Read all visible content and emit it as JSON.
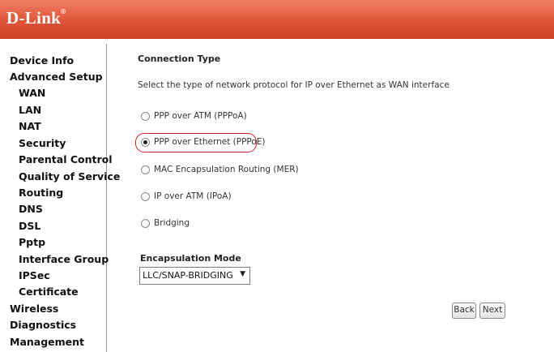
{
  "brand": {
    "logo": "D-Link",
    "tm": "®"
  },
  "sidebar": {
    "items": [
      {
        "label": "Device Info"
      },
      {
        "label": "Advanced Setup"
      },
      {
        "label": "WAN"
      },
      {
        "label": "LAN"
      },
      {
        "label": "NAT"
      },
      {
        "label": "Security"
      },
      {
        "label": "Parental Control"
      },
      {
        "label": "Quality of Service"
      },
      {
        "label": "Routing"
      },
      {
        "label": "DNS"
      },
      {
        "label": "DSL"
      },
      {
        "label": "Pptp"
      },
      {
        "label": "Interface Group"
      },
      {
        "label": "IPSec"
      },
      {
        "label": "Certificate"
      },
      {
        "label": "Wireless"
      },
      {
        "label": "Diagnostics"
      },
      {
        "label": "Management"
      }
    ]
  },
  "main": {
    "title": "Connection Type",
    "description": "Select the type of network protocol for IP over Ethernet as WAN interface",
    "options": [
      {
        "label": "PPP over ATM (PPPoA)"
      },
      {
        "label": "PPP over Ethernet (PPPoE)",
        "selected": true
      },
      {
        "label": "MAC Encapsulation Routing (MER)"
      },
      {
        "label": "IP over ATM (IPoA)"
      },
      {
        "label": "Bridging"
      }
    ],
    "encapsulation": {
      "label": "Encapsulation Mode",
      "value": "LLC/SNAP-BRIDGING"
    },
    "buttons": {
      "back": "Back",
      "next": "Next"
    }
  },
  "colors": {
    "header": "#e0553a",
    "highlight": "#d21e1e"
  }
}
